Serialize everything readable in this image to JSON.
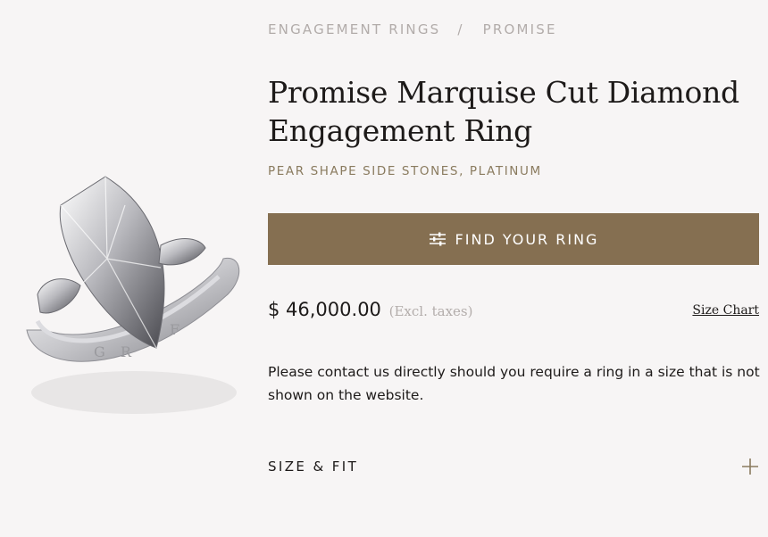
{
  "breadcrumb": {
    "items": [
      "ENGAGEMENT RINGS",
      "PROMISE"
    ],
    "separator": "/"
  },
  "product": {
    "title": "Promise Marquise Cut Diamond Engagement Ring",
    "subtitle": "PEAR SHAPE SIDE STONES, PLATINUM",
    "image_icon": "ring-product-image"
  },
  "cta": {
    "label": "FIND YOUR RING",
    "icon": "sliders-icon",
    "color": "#856f51"
  },
  "price": {
    "amount": "$ 46,000.00",
    "note": "(Excl. taxes)"
  },
  "size_chart_link": "Size Chart",
  "note": "Please contact us directly should you require a ring in a size that is not shown on the website.",
  "accordion": {
    "label": "SIZE & FIT",
    "icon": "plus-icon"
  }
}
